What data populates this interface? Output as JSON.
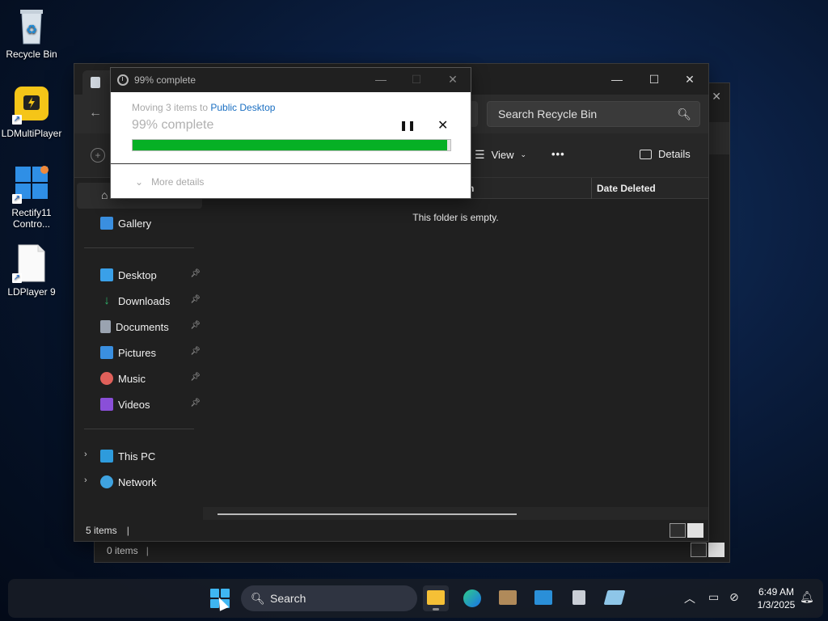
{
  "desktop": {
    "icons": [
      {
        "label": "Recycle Bin",
        "icon": "recycle-bin-icon"
      },
      {
        "label": "LDMultiPlayer",
        "icon": "ldmultiplayer-icon"
      },
      {
        "label": "Rectify11\nContro...",
        "icon": "rectify11-icon"
      },
      {
        "label": "LDPlayer 9",
        "icon": "file-icon"
      }
    ]
  },
  "back_window": {
    "status_count": "0 items"
  },
  "explorer": {
    "search_placeholder": "Search Recycle Bin",
    "toolbar": {
      "view_label": "View",
      "more_label": "•••",
      "details_label": "Details"
    },
    "columns": {
      "name_partial": "n",
      "date_deleted": "Date Deleted"
    },
    "empty_message": "This folder is empty.",
    "sidebar": {
      "gallery": "Gallery",
      "pinned": [
        {
          "label": "Desktop",
          "color": "#3aa0e8"
        },
        {
          "label": "Downloads",
          "color": "#2fb36a"
        },
        {
          "label": "Documents",
          "color": "#9aa3b0"
        },
        {
          "label": "Pictures",
          "color": "#3a8fe0"
        },
        {
          "label": "Music",
          "color": "#e0605a"
        },
        {
          "label": "Videos",
          "color": "#8a4fd8"
        }
      ],
      "this_pc": "This PC",
      "network": "Network"
    },
    "status_count": "5 items"
  },
  "progress_dialog": {
    "title": "99% complete",
    "moving_prefix": "Moving 3 items to ",
    "destination": "Public Desktop",
    "percent_text": "99% complete",
    "progress": 0.99,
    "more_details": "More details",
    "accent": "#06b025"
  },
  "taskbar": {
    "search_label": "Search",
    "time": "6:49 AM",
    "date": "1/3/2025"
  }
}
